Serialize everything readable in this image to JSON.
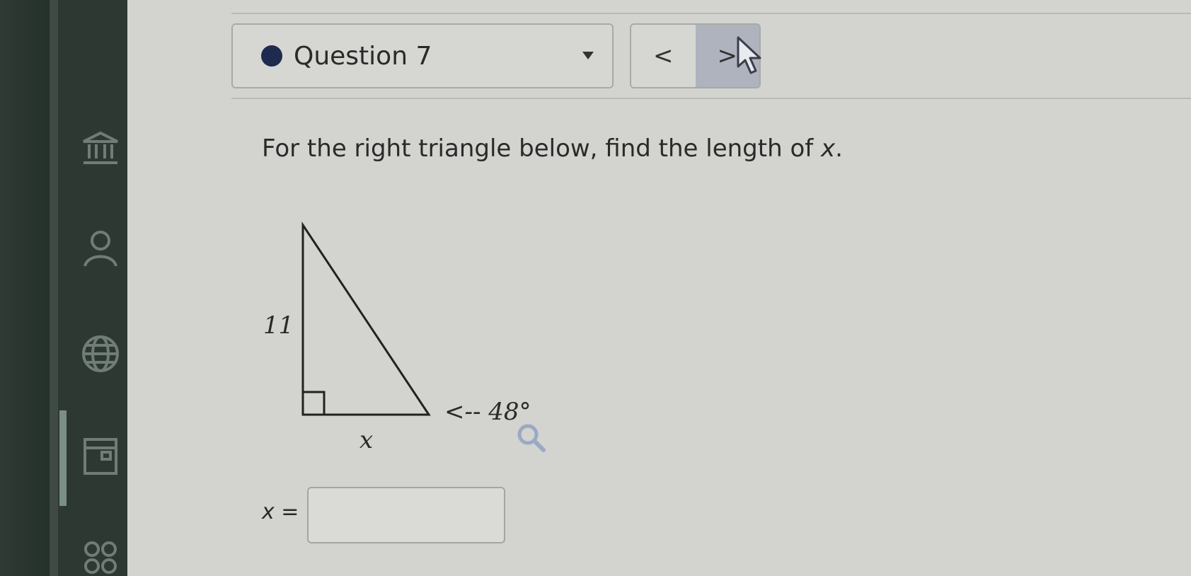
{
  "sidebar": {
    "icons": [
      "bank-icon",
      "person-icon",
      "globe-icon",
      "calendar-icon",
      "group-icon"
    ]
  },
  "question_nav": {
    "label": "Question 7",
    "prev_symbol": "<",
    "next_symbol": ">"
  },
  "problem": {
    "prompt_prefix": "For the right triangle below, find the length of ",
    "prompt_var": "x",
    "prompt_suffix": "."
  },
  "figure": {
    "side_label": "11",
    "base_label": "x",
    "angle_label": "<-- 48°"
  },
  "answer": {
    "var": "x",
    "equals": " =",
    "value": ""
  },
  "colors": {
    "dot": "#1f2a4f",
    "next_button": "#aeb3bd",
    "sidebar": "#2e3833"
  }
}
